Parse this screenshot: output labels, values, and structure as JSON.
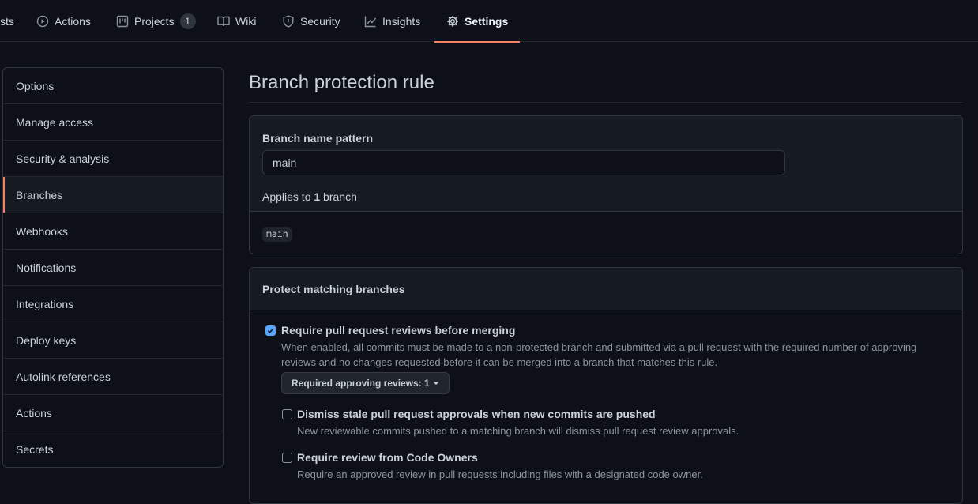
{
  "nav": {
    "tabs": [
      {
        "label": "sts",
        "icon": "pull-request-icon"
      },
      {
        "label": "Actions",
        "icon": "play-icon"
      },
      {
        "label": "Projects",
        "icon": "project-icon",
        "counter": "1"
      },
      {
        "label": "Wiki",
        "icon": "book-icon"
      },
      {
        "label": "Security",
        "icon": "shield-icon"
      },
      {
        "label": "Insights",
        "icon": "graph-icon"
      },
      {
        "label": "Settings",
        "icon": "gear-icon",
        "active": true
      }
    ],
    "active_color": "#f78166"
  },
  "sidebar": {
    "items": [
      {
        "label": "Options"
      },
      {
        "label": "Manage access"
      },
      {
        "label": "Security & analysis"
      },
      {
        "label": "Branches",
        "selected": true
      },
      {
        "label": "Webhooks"
      },
      {
        "label": "Notifications"
      },
      {
        "label": "Integrations"
      },
      {
        "label": "Deploy keys"
      },
      {
        "label": "Autolink references"
      },
      {
        "label": "Actions"
      },
      {
        "label": "Secrets"
      }
    ]
  },
  "main": {
    "title": "Branch protection rule",
    "pattern": {
      "label": "Branch name pattern",
      "value": "main",
      "applies_prefix": "Applies to ",
      "applies_count": "1",
      "applies_suffix": " branch",
      "matched_branch": "main"
    },
    "protect": {
      "heading": "Protect matching branches",
      "rules": [
        {
          "title": "Require pull request reviews before merging",
          "checked": true,
          "desc": "When enabled, all commits must be made to a non-protected branch and submitted via a pull request with the required number of approving reviews and no changes requested before it can be merged into a branch that matches this rule."
        },
        {
          "title": "Dismiss stale pull request approvals when new commits are pushed",
          "checked": false,
          "desc": "New reviewable commits pushed to a matching branch will dismiss pull request review approvals."
        },
        {
          "title": "Require review from Code Owners",
          "checked": false,
          "desc": "Require an approved review in pull requests including files with a designated code owner."
        }
      ],
      "approving_reviews_label": "Required approving reviews: 1"
    }
  },
  "colors": {
    "background": "#0d1117",
    "panel": "#161b22",
    "border": "#30363d",
    "checkbox_accent": "#58a6ff"
  }
}
